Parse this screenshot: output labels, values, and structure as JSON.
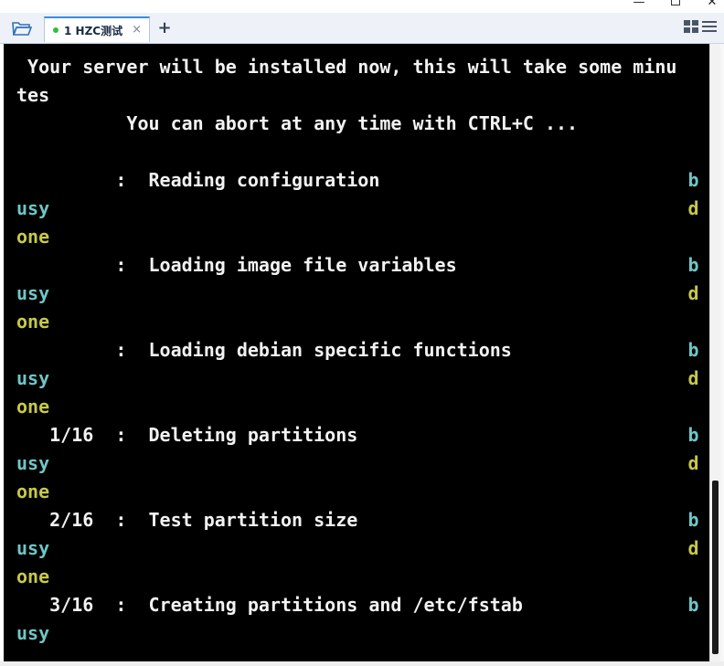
{
  "window": {
    "controls": [
      "minimize",
      "maximize",
      "close"
    ]
  },
  "tabbar": {
    "tab_label": "1 HZC测试",
    "tab_close": "×",
    "add_tab": "+",
    "status_color": "#2fbf3d",
    "icons": [
      "folder-open-icon",
      "grid-view-icon",
      "menu-icon"
    ]
  },
  "terminal": {
    "lines": [
      {
        "text": " Your server will be installed now, this will take some minu",
        "color": "white"
      },
      {
        "text": "tes",
        "color": "white"
      },
      {
        "text": "          You can abort at any time with CTRL+C ...",
        "color": "white"
      },
      {
        "text": "",
        "color": "white"
      },
      {
        "text": "         :  Reading configuration",
        "color": "white",
        "suffix": "b",
        "suffix_color": "cyan"
      },
      {
        "text": "usy",
        "color": "cyan",
        "suffix": "d",
        "suffix_color": "yellow"
      },
      {
        "text": "one",
        "color": "yellow"
      },
      {
        "text": "         :  Loading image file variables",
        "color": "white",
        "suffix": "b",
        "suffix_color": "cyan"
      },
      {
        "text": "usy",
        "color": "cyan",
        "suffix": "d",
        "suffix_color": "yellow"
      },
      {
        "text": "one",
        "color": "yellow"
      },
      {
        "text": "         :  Loading debian specific functions",
        "color": "white",
        "suffix": "b",
        "suffix_color": "cyan"
      },
      {
        "text": "usy",
        "color": "cyan",
        "suffix": "d",
        "suffix_color": "yellow"
      },
      {
        "text": "one",
        "color": "yellow"
      },
      {
        "text": "   1/16  :  Deleting partitions",
        "color": "white",
        "suffix": "b",
        "suffix_color": "cyan"
      },
      {
        "text": "usy",
        "color": "cyan",
        "suffix": "d",
        "suffix_color": "yellow"
      },
      {
        "text": "one",
        "color": "yellow"
      },
      {
        "text": "   2/16  :  Test partition size",
        "color": "white",
        "suffix": "b",
        "suffix_color": "cyan"
      },
      {
        "text": "usy",
        "color": "cyan",
        "suffix": "d",
        "suffix_color": "yellow"
      },
      {
        "text": "one",
        "color": "yellow"
      },
      {
        "text": "   3/16  :  Creating partitions and /etc/fstab",
        "color": "white",
        "suffix": "b",
        "suffix_color": "cyan"
      },
      {
        "text": "usy",
        "color": "cyan"
      }
    ],
    "colors": {
      "background": "#000000",
      "white": "#f2f2f2",
      "cyan": "#6fc6c6",
      "yellow": "#c8c84a"
    }
  }
}
